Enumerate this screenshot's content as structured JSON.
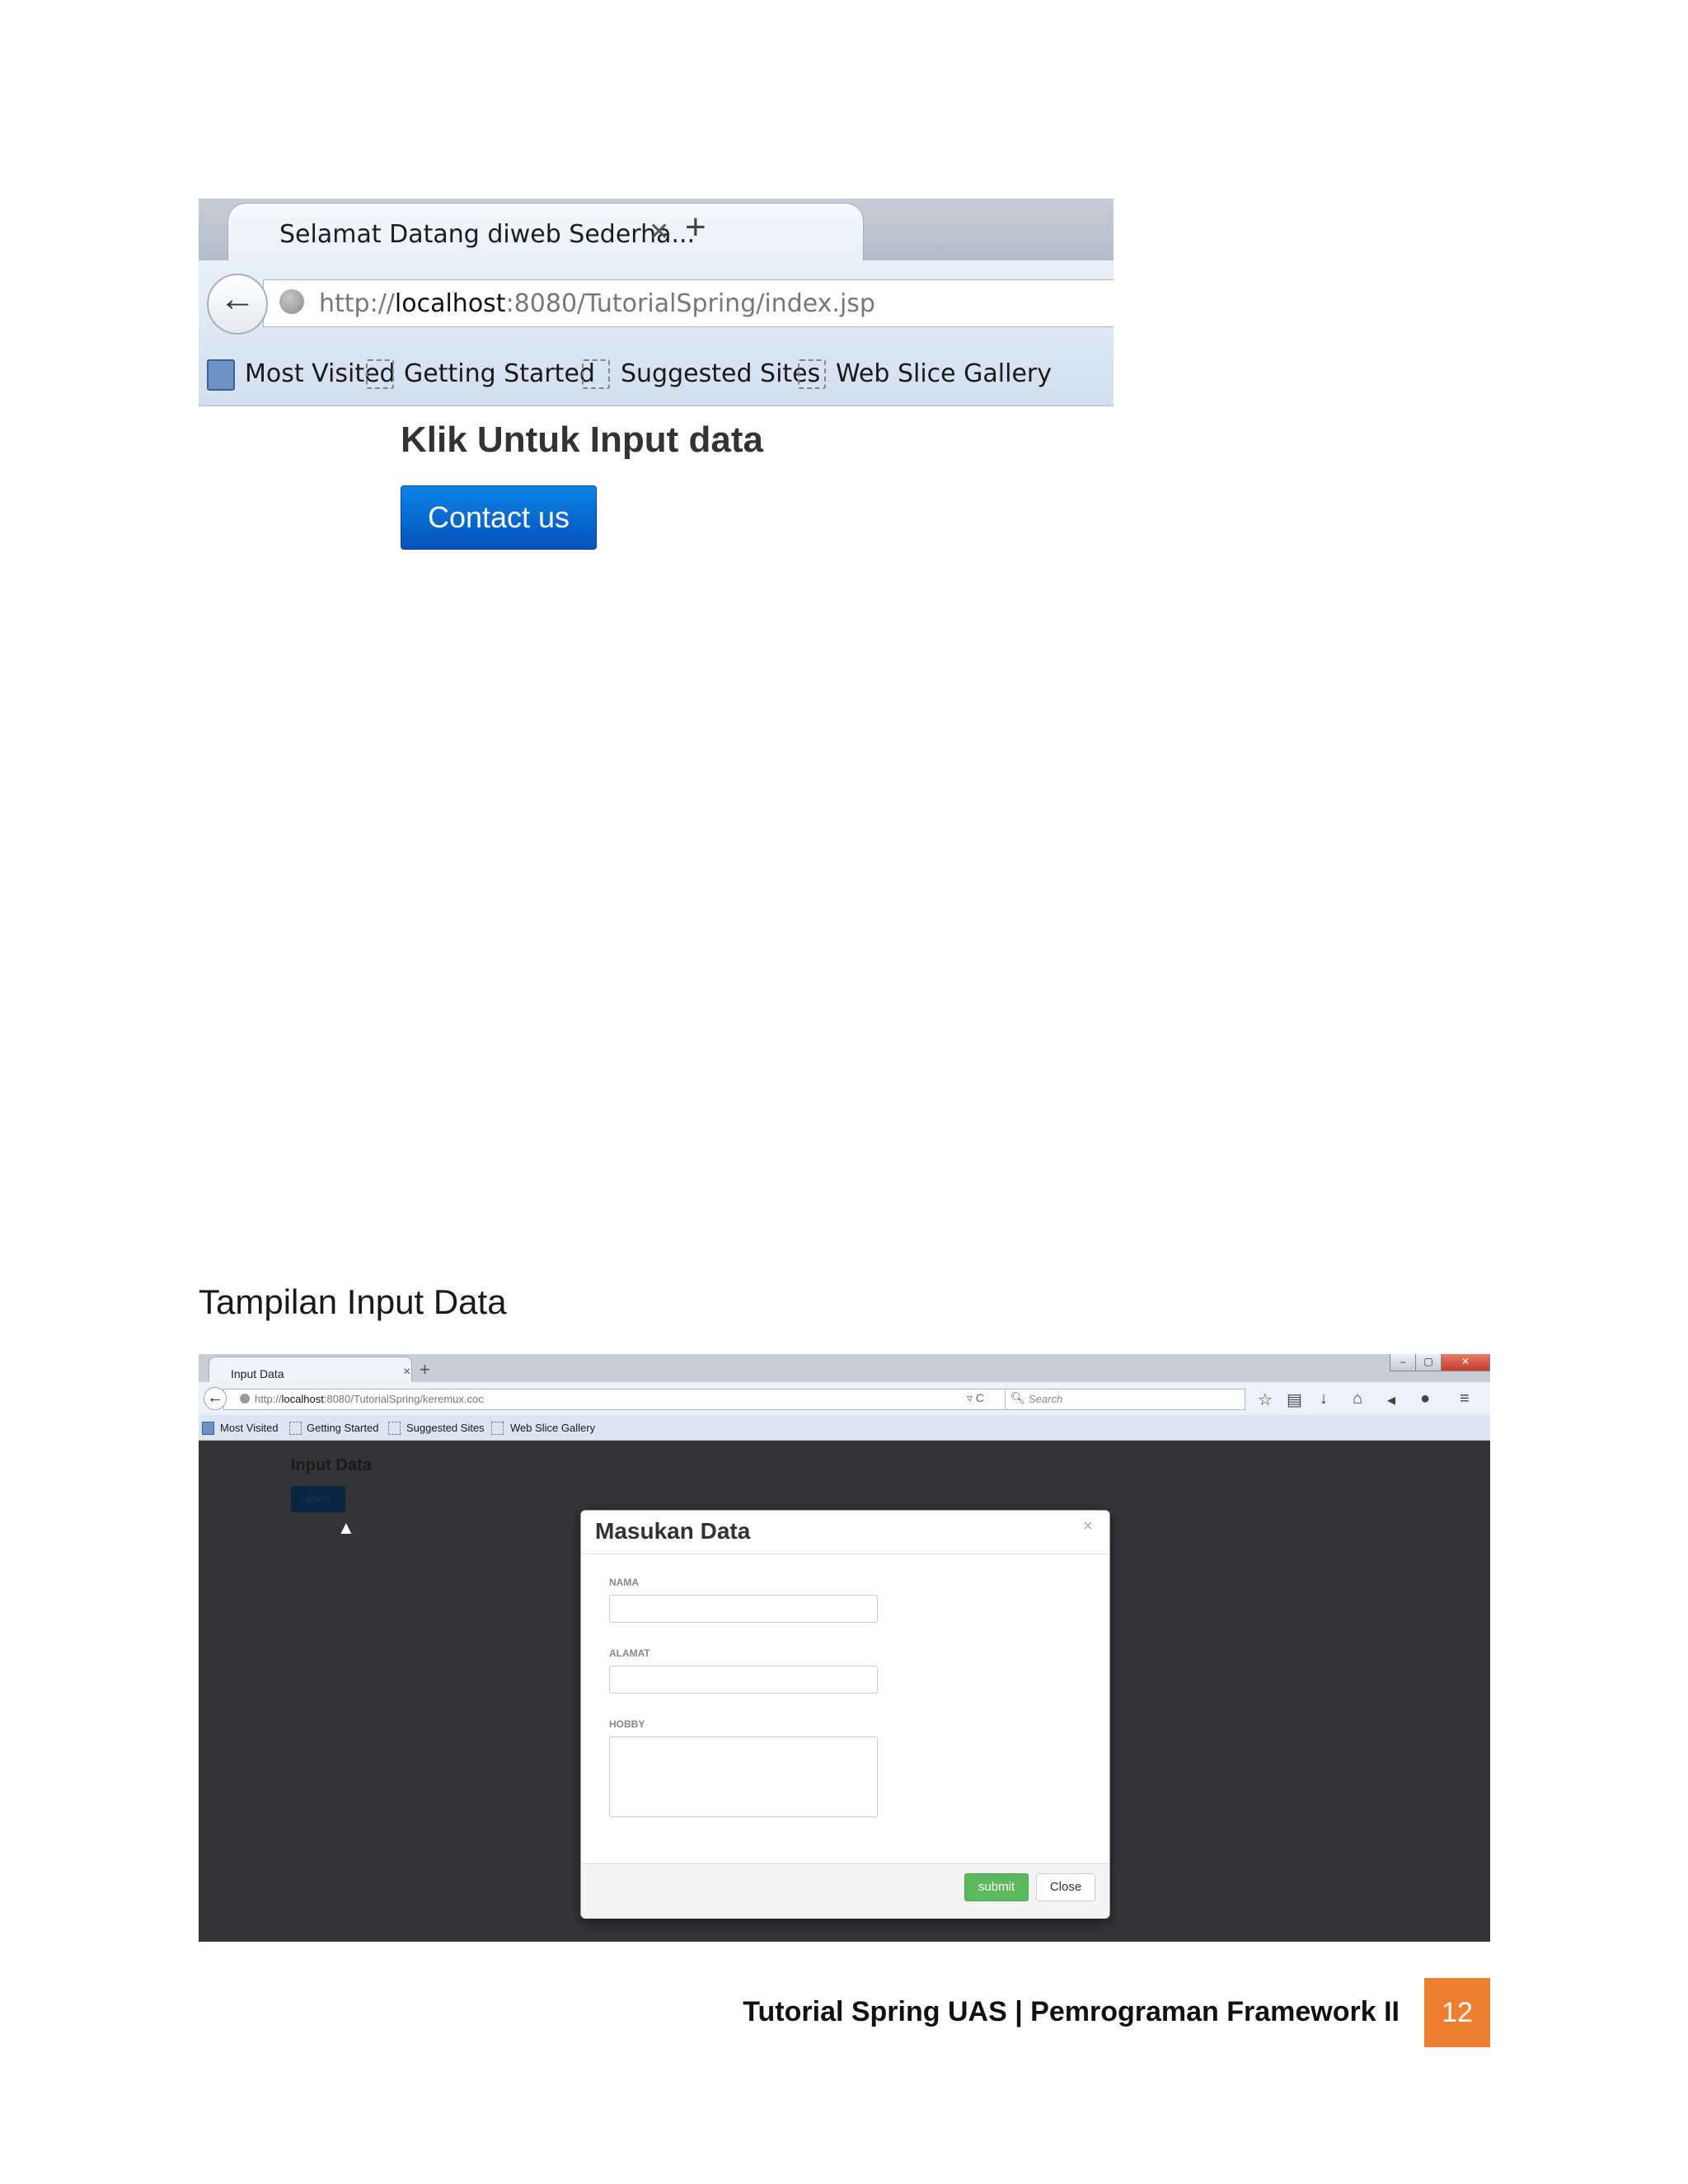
{
  "shot1": {
    "tab_title": "Selamat Datang diweb Sederha...",
    "tab_close": "✕",
    "new_tab": "+",
    "back": "🡐",
    "url_prefix": "http://",
    "url_host": "localhost",
    "url_rest": ":8080/TutorialSpring/index.jsp",
    "bookmarks": [
      "Most Visited",
      "Getting Started",
      "Suggested Sites",
      "Web Slice Gallery"
    ],
    "heading": "Klik Untuk Input data",
    "button": "Contact us"
  },
  "caption": "Tampilan Input Data",
  "shot2": {
    "tab_title": "Input Data",
    "tab_close": "×",
    "new_tab": "+",
    "window_buttons": [
      "–",
      "▢",
      "✕"
    ],
    "back": "←",
    "url_prefix": "http://",
    "url_host": "localhost",
    "url_rest": ":8080/TutorialSpring/keremux.coc",
    "url_controls": "▿ C",
    "search_placeholder": "Search",
    "toolbar_icons": [
      "star-icon",
      "clipboard-icon",
      "download-icon",
      "home-icon",
      "send-icon",
      "chat-icon",
      "menu-icon"
    ],
    "bookmarks": [
      "Most Visited",
      "Getting Started",
      "Suggested Sites",
      "Web Slice Gallery"
    ],
    "page_heading": "Input Data",
    "page_button": "Klik!!!",
    "modal": {
      "title": "Masukan Data",
      "close": "×",
      "fields": [
        "NAMA",
        "ALAMAT",
        "HOBBY"
      ],
      "submit": "submit",
      "close_button": "Close"
    }
  },
  "footer": {
    "text": "Tutorial Spring UAS | Pemrograman Framework II",
    "page": "12",
    "accent": "#ed7d31"
  }
}
